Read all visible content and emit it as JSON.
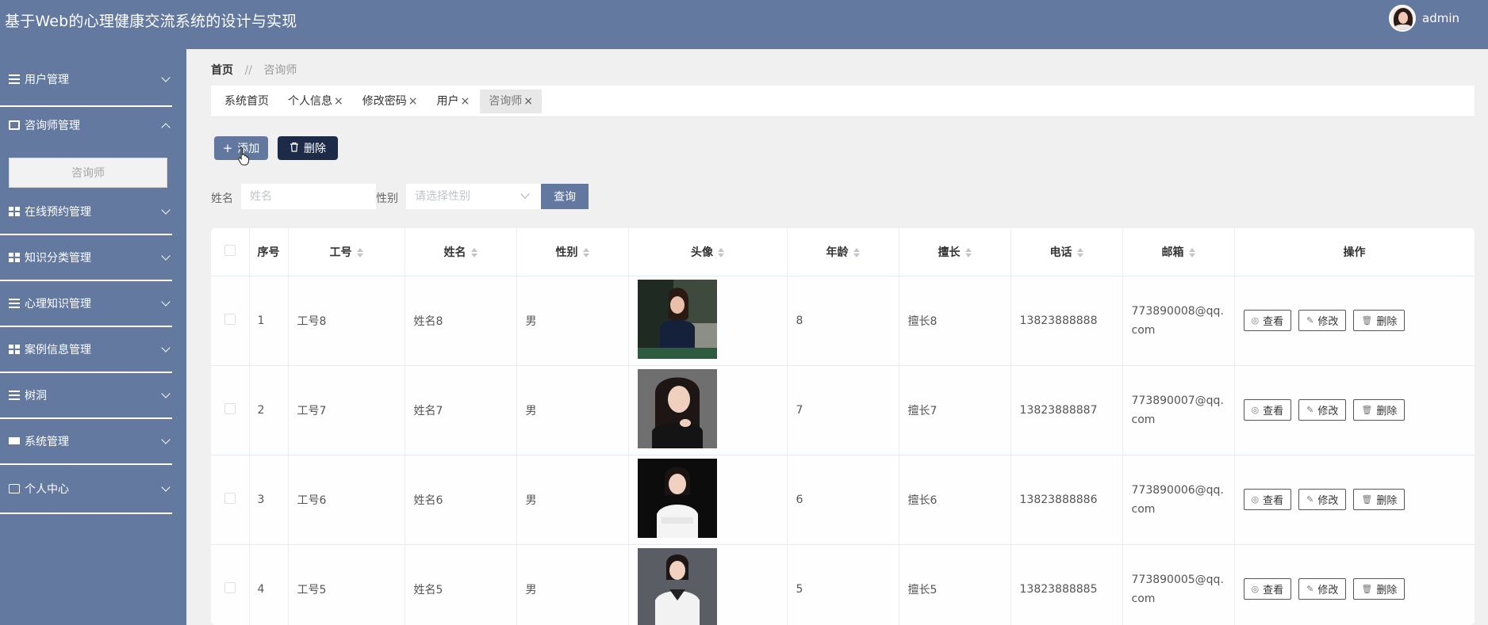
{
  "header": {
    "title": "基于Web的心理健康交流系统的设计与实现",
    "user_name": "admin"
  },
  "sidebar": {
    "items": [
      {
        "label": "用户管理",
        "icon": "list-icon",
        "expanded": false
      },
      {
        "label": "咨询师管理",
        "icon": "clipboard-icon",
        "expanded": true
      },
      {
        "label": "在线预约管理",
        "icon": "grid-icon",
        "expanded": false
      },
      {
        "label": "知识分类管理",
        "icon": "grid-icon",
        "expanded": false
      },
      {
        "label": "心理知识管理",
        "icon": "list-icon",
        "expanded": false
      },
      {
        "label": "案例信息管理",
        "icon": "grid-icon",
        "expanded": false
      },
      {
        "label": "树洞",
        "icon": "sliders-icon",
        "expanded": false
      },
      {
        "label": "系统管理",
        "icon": "monitor-icon",
        "expanded": false
      },
      {
        "label": "个人中心",
        "icon": "card-icon",
        "expanded": false
      }
    ],
    "submenu_active": "咨询师"
  },
  "breadcrumb": {
    "home": "首页",
    "separator": "//",
    "current": "咨询师"
  },
  "tabs": [
    {
      "label": "系统首页",
      "closable": false,
      "active": false
    },
    {
      "label": "个人信息",
      "closable": true,
      "active": false
    },
    {
      "label": "修改密码",
      "closable": true,
      "active": false
    },
    {
      "label": "用户",
      "closable": true,
      "active": false
    },
    {
      "label": "咨询师",
      "closable": true,
      "active": true
    }
  ],
  "tab_close": "×",
  "toolbar": {
    "add_label": "添加",
    "delete_label": "删除"
  },
  "filters": {
    "name_label": "姓名",
    "name_placeholder": "姓名",
    "gender_label": "性别",
    "gender_placeholder": "请选择性别",
    "search_label": "查询"
  },
  "table": {
    "columns": [
      "序号",
      "工号",
      "姓名",
      "性别",
      "头像",
      "年龄",
      "擅长",
      "电话",
      "邮箱",
      "操作"
    ],
    "rows": [
      {
        "index": "1",
        "job_no": "工号8",
        "name": "姓名8",
        "gender": "男",
        "age": "8",
        "specialty": "擅长8",
        "phone": "13823888888",
        "email": "773890008@qq.com"
      },
      {
        "index": "2",
        "job_no": "工号7",
        "name": "姓名7",
        "gender": "男",
        "age": "7",
        "specialty": "擅长7",
        "phone": "13823888887",
        "email": "773890007@qq.com"
      },
      {
        "index": "3",
        "job_no": "工号6",
        "name": "姓名6",
        "gender": "男",
        "age": "6",
        "specialty": "擅长6",
        "phone": "13823888886",
        "email": "773890006@qq.com"
      },
      {
        "index": "4",
        "job_no": "工号5",
        "name": "姓名5",
        "gender": "男",
        "age": "5",
        "specialty": "擅长5",
        "phone": "13823888885",
        "email": "773890005@qq.com"
      }
    ],
    "actions": {
      "view": "查看",
      "edit": "修改",
      "delete": "删除"
    }
  },
  "colors": {
    "primary": "#64799f",
    "dark_button": "#1d2b49",
    "background": "#f0f0f1"
  }
}
